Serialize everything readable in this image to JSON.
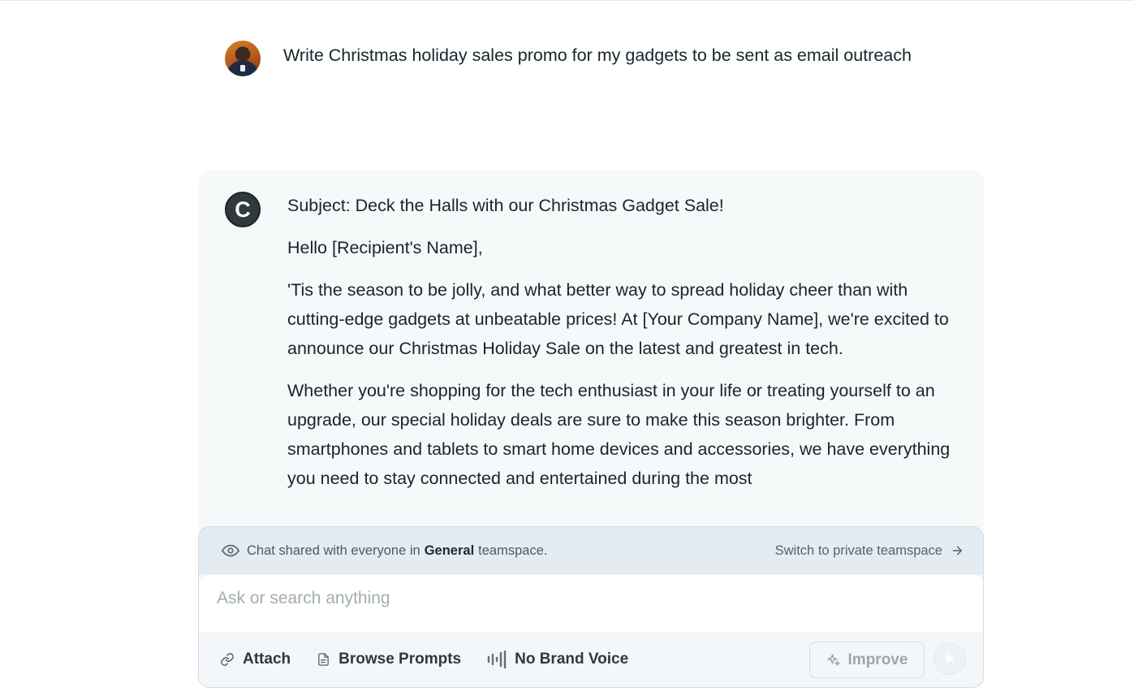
{
  "user_message": {
    "text": "Write Christmas holiday sales promo for my gadgets to be sent as email outreach"
  },
  "assistant_message": {
    "avatar_letter": "C",
    "paragraphs": [
      "Subject: Deck the Halls with our Christmas Gadget Sale!",
      "Hello [Recipient's Name],",
      "'Tis the season to be jolly, and what better way to spread holiday cheer than with cutting-edge gadgets at unbeatable prices! At [Your Company Name], we're excited to announce our Christmas Holiday Sale on the latest and greatest in tech.",
      "Whether you're shopping for the tech enthusiast in your life or treating yourself to an upgrade, our special holiday deals are sure to make this season brighter. From smartphones and tablets to smart home devices and accessories, we have everything you need to stay connected and entertained during the most"
    ]
  },
  "share_bar": {
    "prefix": "Chat shared with everyone in",
    "teamspace": "General",
    "suffix": "teamspace.",
    "switch_label": "Switch to private teamspace"
  },
  "composer": {
    "placeholder": "Ask or search anything",
    "attach_label": "Attach",
    "browse_prompts_label": "Browse Prompts",
    "brand_voice_label": "No Brand Voice",
    "improve_label": "Improve"
  }
}
